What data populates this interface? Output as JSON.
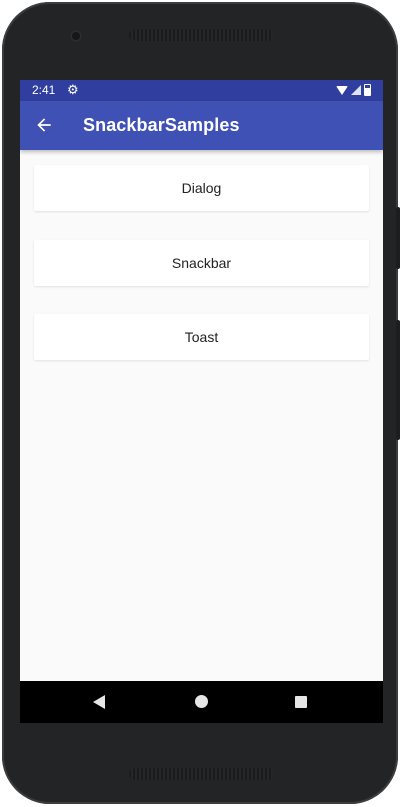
{
  "status_bar": {
    "time": "2:41"
  },
  "app_bar": {
    "title": "SnackbarSamples"
  },
  "buttons": [
    {
      "label": "Dialog"
    },
    {
      "label": "Snackbar"
    },
    {
      "label": "Toast"
    }
  ],
  "colors": {
    "status_bar": "#303f9f",
    "app_bar": "#3f51b5",
    "background": "#fafafa",
    "nav_bar": "#000000"
  },
  "icons": {
    "status": [
      "gear-icon",
      "wifi-icon",
      "signal-icon",
      "battery-icon"
    ],
    "app_bar": "back-arrow-icon",
    "nav": [
      "nav-back-icon",
      "nav-home-icon",
      "nav-recents-icon"
    ]
  }
}
